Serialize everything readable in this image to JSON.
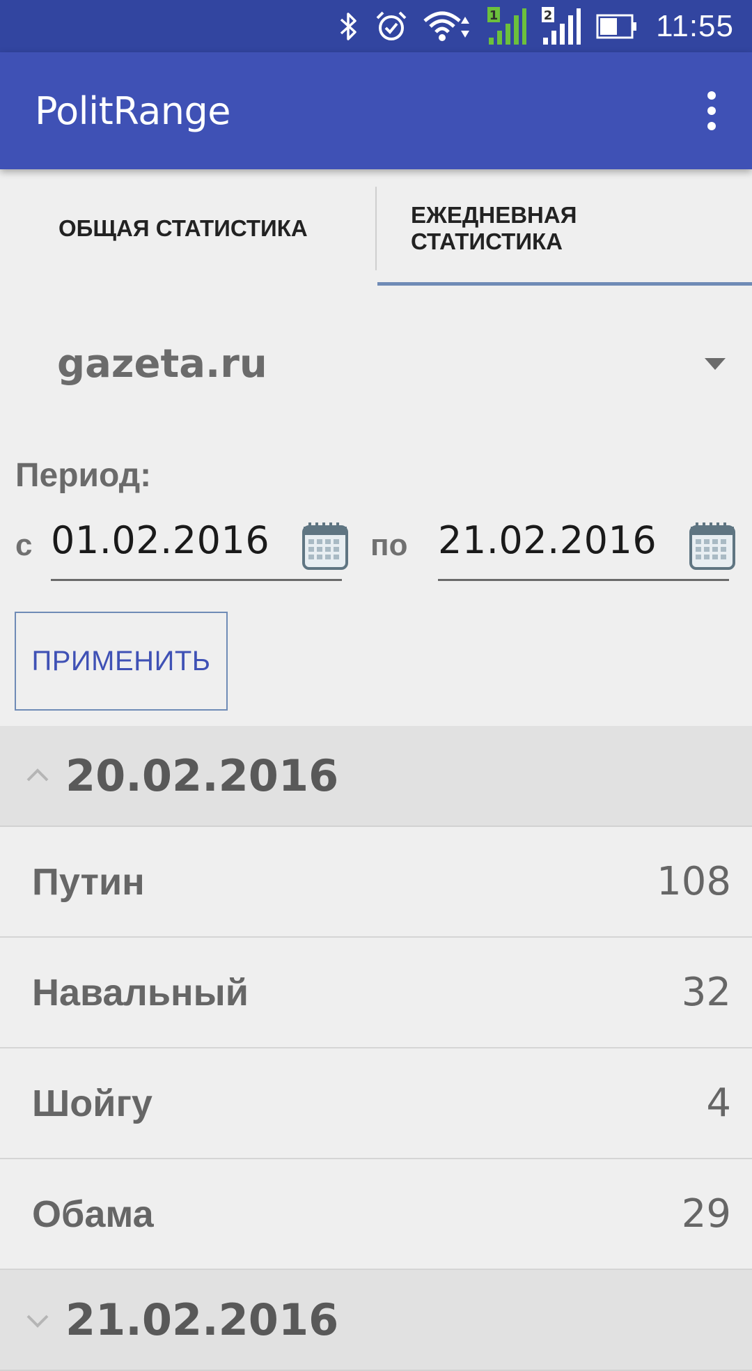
{
  "status_bar": {
    "time": "11:55",
    "icons": [
      "bluetooth-icon",
      "alarm-icon",
      "wifi-icon",
      "signal-sim1-icon",
      "signal-sim2-icon",
      "battery-icon"
    ],
    "sim1_label": "1",
    "sim2_label": "2"
  },
  "app_bar": {
    "title": "PolitRange",
    "menu_icon": "overflow-menu-icon"
  },
  "tabs": [
    {
      "label": "ОБЩАЯ СТАТИСТИКА",
      "selected": false
    },
    {
      "label_line1": "ЕЖЕДНЕВНАЯ",
      "label_line2": "СТАТИСТИКА",
      "selected": true
    }
  ],
  "source_select": {
    "selected": "gazeta.ru"
  },
  "period": {
    "label": "Период:",
    "from_prefix": "с",
    "from_value": "01.02.2016",
    "to_prefix": "по",
    "to_value": "21.02.2016"
  },
  "apply_button": {
    "label": "ПРИМЕНИТЬ"
  },
  "groups": [
    {
      "date": "20.02.2016",
      "expanded": true,
      "rows": [
        {
          "name": "Путин",
          "count": "108"
        },
        {
          "name": "Навальный",
          "count": "32"
        },
        {
          "name": "Шойгу",
          "count": "4"
        },
        {
          "name": "Обама",
          "count": "29"
        }
      ]
    },
    {
      "date": "21.02.2016",
      "expanded": false,
      "rows": []
    }
  ],
  "colors": {
    "status_bar": "#3245a0",
    "app_bar": "#3f51b5",
    "accent": "#3f51b5",
    "tab_indicator": "#6f8bb6",
    "background": "#efefef",
    "group_header": "#e1e1e1",
    "signal_sim1": "#6cc03c"
  }
}
